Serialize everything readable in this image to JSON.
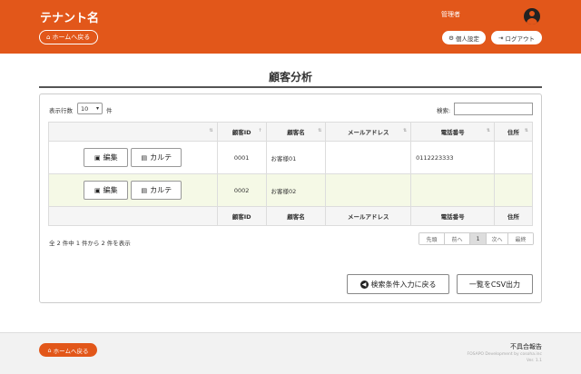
{
  "header": {
    "tenant_name": "テナント名",
    "home_button": "ホームへ戻る",
    "admin_label": "管理者",
    "profile_button": "個人設定",
    "logout_button": "ログアウト"
  },
  "page": {
    "title": "顧客分析"
  },
  "controls": {
    "length_label": "表示行数",
    "length_value": "10",
    "length_suffix": "件",
    "search_label": "検索:",
    "search_value": ""
  },
  "table": {
    "columns": [
      "",
      "顧客ID",
      "顧客名",
      "メールアドレス",
      "電話番号",
      "住所"
    ],
    "rows": [
      {
        "id": "0001",
        "name": "お客様01",
        "email": "",
        "tel": "0112223333",
        "address": ""
      },
      {
        "id": "0002",
        "name": "お客様02",
        "email": "",
        "tel": "",
        "address": ""
      }
    ],
    "edit_label": "編集",
    "karte_label": "カルテ"
  },
  "info_text": "全 2 件中 1 件から 2 件を表示",
  "pager": {
    "first": "先頭",
    "prev": "前へ",
    "current": "1",
    "next": "次へ",
    "last": "最終"
  },
  "actions": {
    "back_label": "検索条件入力に戻る",
    "csv_label": "一覧をCSV出力"
  },
  "footer": {
    "home_button": "ホームへ戻る",
    "defect_report": "不具合報告",
    "copyright": "FOSAPO Development by cosoha.inc",
    "version": "Ver. 1.1"
  },
  "colors": {
    "brand": "#e2571a",
    "row_alt": "#f5f9e6"
  }
}
